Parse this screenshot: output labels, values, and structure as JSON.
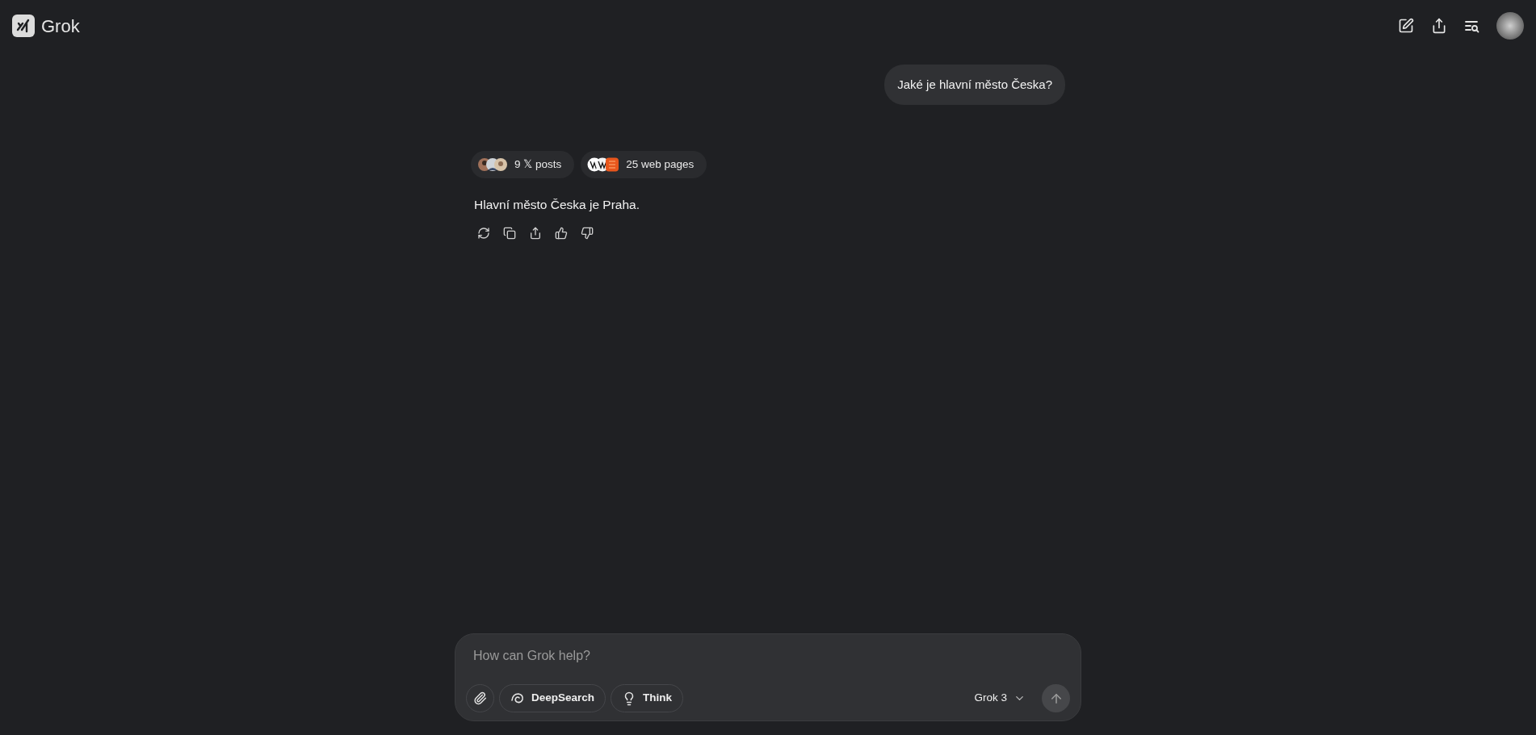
{
  "header": {
    "brand": "Grok"
  },
  "conversation": [
    {
      "kind": "user",
      "text": "Jaké je hlavní město Česka?"
    },
    {
      "kind": "assistant",
      "sources": [
        {
          "kind": "posts",
          "label": "9 𝕏 posts"
        },
        {
          "kind": "web",
          "label": "25 web pages"
        }
      ],
      "text": "Hlavní město Česka je Praha."
    }
  ],
  "composer": {
    "placeholder": "How can Grok help?",
    "tools": [
      {
        "kind": "deepsearch",
        "label": "DeepSearch"
      },
      {
        "kind": "think",
        "label": "Think"
      }
    ],
    "model": "Grok 3"
  }
}
